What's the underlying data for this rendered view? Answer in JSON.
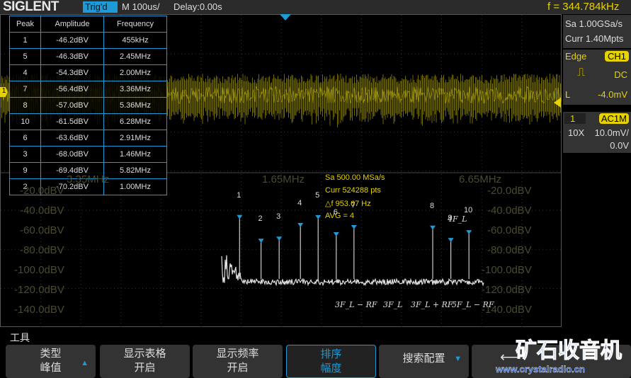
{
  "header": {
    "brand": "SIGLENT",
    "trig_status": "Trig'd",
    "timebase": "M 100us/",
    "delay": "Delay:0.00s",
    "frequency": "f = 344.784kHz"
  },
  "acquire": {
    "sample_rate": "Sa 1.00GSa/s",
    "memory": "Curr 1.40Mpts"
  },
  "trigger": {
    "type": "Edge",
    "source": "CH1",
    "coupling": "DC",
    "level_label": "L",
    "level": "-4.0mV",
    "slope_icon": "rising-edge-icon"
  },
  "channel": {
    "number": "1",
    "coupling": "AC1M",
    "probe": "10X",
    "scale": "10.0mV/",
    "offset": "0.0V",
    "color": "#e6d200"
  },
  "peak_table": {
    "headers": [
      "Peak",
      "Amplitude",
      "Frequency"
    ],
    "rows": [
      [
        "1",
        "-46.2dBV",
        "455kHz"
      ],
      [
        "5",
        "-46.3dBV",
        "2.45MHz"
      ],
      [
        "4",
        "-54.3dBV",
        "2.00MHz"
      ],
      [
        "7",
        "-56.4dBV",
        "3.36MHz"
      ],
      [
        "8",
        "-57.0dBV",
        "5.36MHz"
      ],
      [
        "10",
        "-61.5dBV",
        "6.28MHz"
      ],
      [
        "6",
        "-63.6dBV",
        "2.91MHz"
      ],
      [
        "3",
        "-68.0dBV",
        "1.46MHz"
      ],
      [
        "9",
        "-69.4dBV",
        "5.82MHz"
      ],
      [
        "2",
        "-70.2dBV",
        "1.00MHz"
      ]
    ]
  },
  "fft": {
    "sample_rate": "Sa 500.00 MSa/s",
    "points": "Curr 524288 pts",
    "delta_f": "△f 953.67 Hz",
    "avg": "AVG = 4",
    "freq_labels": [
      "3.35MHz",
      "1.65MHz",
      "6.65MHz"
    ],
    "y_labels": [
      "-20.0dBV",
      "-40.0dBV",
      "-60.0dBV",
      "-80.0dBV",
      "-100.0dBV",
      "-120.0dBV",
      "-140.0dBV"
    ],
    "marker_color": "#1e9ad6",
    "peaks": [
      {
        "n": "1",
        "f_mhz": 0.455,
        "dbv": -46.2
      },
      {
        "n": "2",
        "f_mhz": 1.0,
        "dbv": -70.2
      },
      {
        "n": "3",
        "f_mhz": 1.46,
        "dbv": -68.0
      },
      {
        "n": "4",
        "f_mhz": 2.0,
        "dbv": -54.3
      },
      {
        "n": "5",
        "f_mhz": 2.45,
        "dbv": -46.3
      },
      {
        "n": "6",
        "f_mhz": 2.91,
        "dbv": -63.6
      },
      {
        "n": "7",
        "f_mhz": 3.36,
        "dbv": -56.4
      },
      {
        "n": "8",
        "f_mhz": 5.36,
        "dbv": -57.0
      },
      {
        "n": "9",
        "f_mhz": 5.82,
        "dbv": -69.4
      },
      {
        "n": "10",
        "f_mhz": 6.28,
        "dbv": -61.5
      }
    ],
    "annotations": [
      "3F_L − RF",
      "3F_L",
      "3F_L + RF",
      "5F_L − RF",
      "4F_L"
    ]
  },
  "menu": {
    "title": "工具",
    "buttons": [
      {
        "top": "类型",
        "bottom": "峰值"
      },
      {
        "top": "显示表格",
        "bottom": "开启"
      },
      {
        "top": "显示频率",
        "bottom": "开启"
      },
      {
        "top": "排序",
        "bottom": "幅度"
      },
      {
        "top": "搜索配置",
        "bottom": ""
      }
    ]
  },
  "watermark": {
    "text": "矿石收音机",
    "url": "www.crystalradio.cn"
  }
}
